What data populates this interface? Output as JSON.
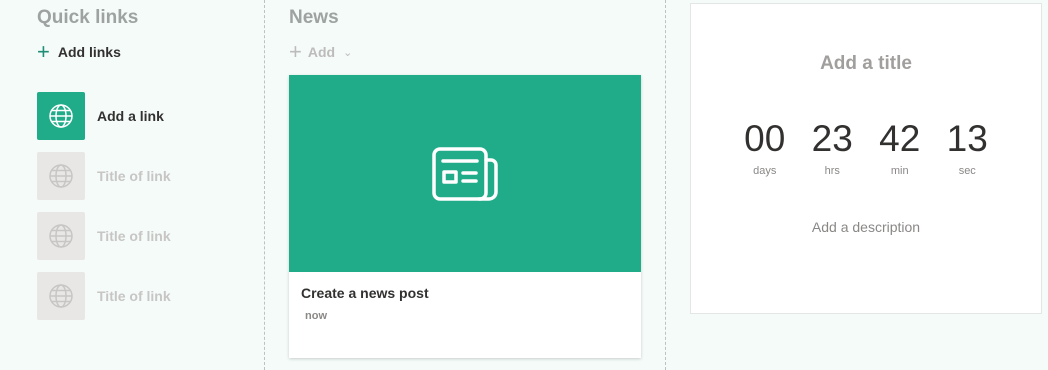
{
  "quick_links": {
    "title": "Quick links",
    "add_label": "Add links",
    "items": [
      {
        "label": "Add a link",
        "state": "active"
      },
      {
        "label": "Title of link",
        "state": "ghost"
      },
      {
        "label": "Title of link",
        "state": "ghost"
      },
      {
        "label": "Title of link",
        "state": "ghost"
      }
    ]
  },
  "news": {
    "title": "News",
    "add_label": "Add",
    "card": {
      "headline": "Create a news post",
      "time": "now"
    }
  },
  "countdown": {
    "title": "Add a title",
    "units": [
      {
        "value": "00",
        "label": "days"
      },
      {
        "value": "23",
        "label": "hrs"
      },
      {
        "value": "42",
        "label": "min"
      },
      {
        "value": "13",
        "label": "sec"
      }
    ],
    "description": "Add a description"
  },
  "colors": {
    "accent": "#20ac89",
    "page_background": "#f4fbf9",
    "ghost_tile": "#e8e7e6"
  }
}
